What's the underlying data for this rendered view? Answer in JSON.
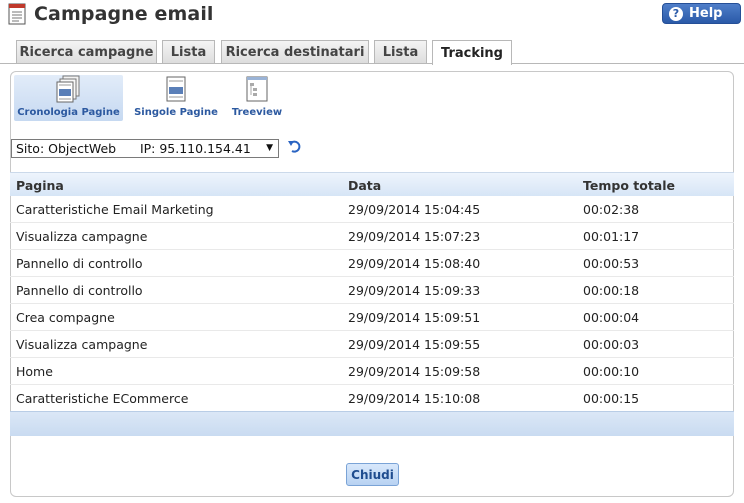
{
  "header": {
    "title": "Campagne email",
    "help_label": "Help",
    "help_icon": "question-icon"
  },
  "tabs": [
    {
      "label": "Ricerca campagne",
      "active": false
    },
    {
      "label": "Lista",
      "active": false
    },
    {
      "label": "Ricerca destinatari",
      "active": false
    },
    {
      "label": "Lista",
      "active": false
    },
    {
      "label": "Tracking",
      "active": true
    }
  ],
  "toolbar": {
    "items": [
      {
        "label": "Cronologia Pagine",
        "icon": "page-history-icon",
        "active": true
      },
      {
        "label": "Singole Pagine",
        "icon": "single-page-icon",
        "active": false
      },
      {
        "label": "Treeview",
        "icon": "treeview-icon",
        "active": false
      }
    ]
  },
  "site_select": {
    "value": "Sito: ObjectWeb      IP: 95.110.154.41"
  },
  "table": {
    "columns": [
      "Pagina",
      "Data",
      "Tempo totale"
    ],
    "rows": [
      [
        "Caratteristiche Email Marketing",
        "29/09/2014 15:04:45",
        "00:02:38"
      ],
      [
        "Visualizza campagne",
        "29/09/2014 15:07:23",
        "00:01:17"
      ],
      [
        "Pannello di controllo",
        "29/09/2014 15:08:40",
        "00:00:53"
      ],
      [
        "Pannello di controllo",
        "29/09/2014 15:09:33",
        "00:00:18"
      ],
      [
        "Crea compagne",
        "29/09/2014 15:09:51",
        "00:00:04"
      ],
      [
        "Visualizza campagne",
        "29/09/2014 15:09:55",
        "00:00:03"
      ],
      [
        "Home",
        "29/09/2014 15:09:58",
        "00:00:10"
      ],
      [
        "Caratteristiche ECommerce",
        "29/09/2014 15:10:08",
        "00:00:15"
      ]
    ]
  },
  "footer": {
    "close_label": "Chiudi"
  },
  "colors": {
    "accent": "#2c59a0",
    "help_button": "#2a5aa8",
    "grid_header": "#d6e5f6"
  }
}
